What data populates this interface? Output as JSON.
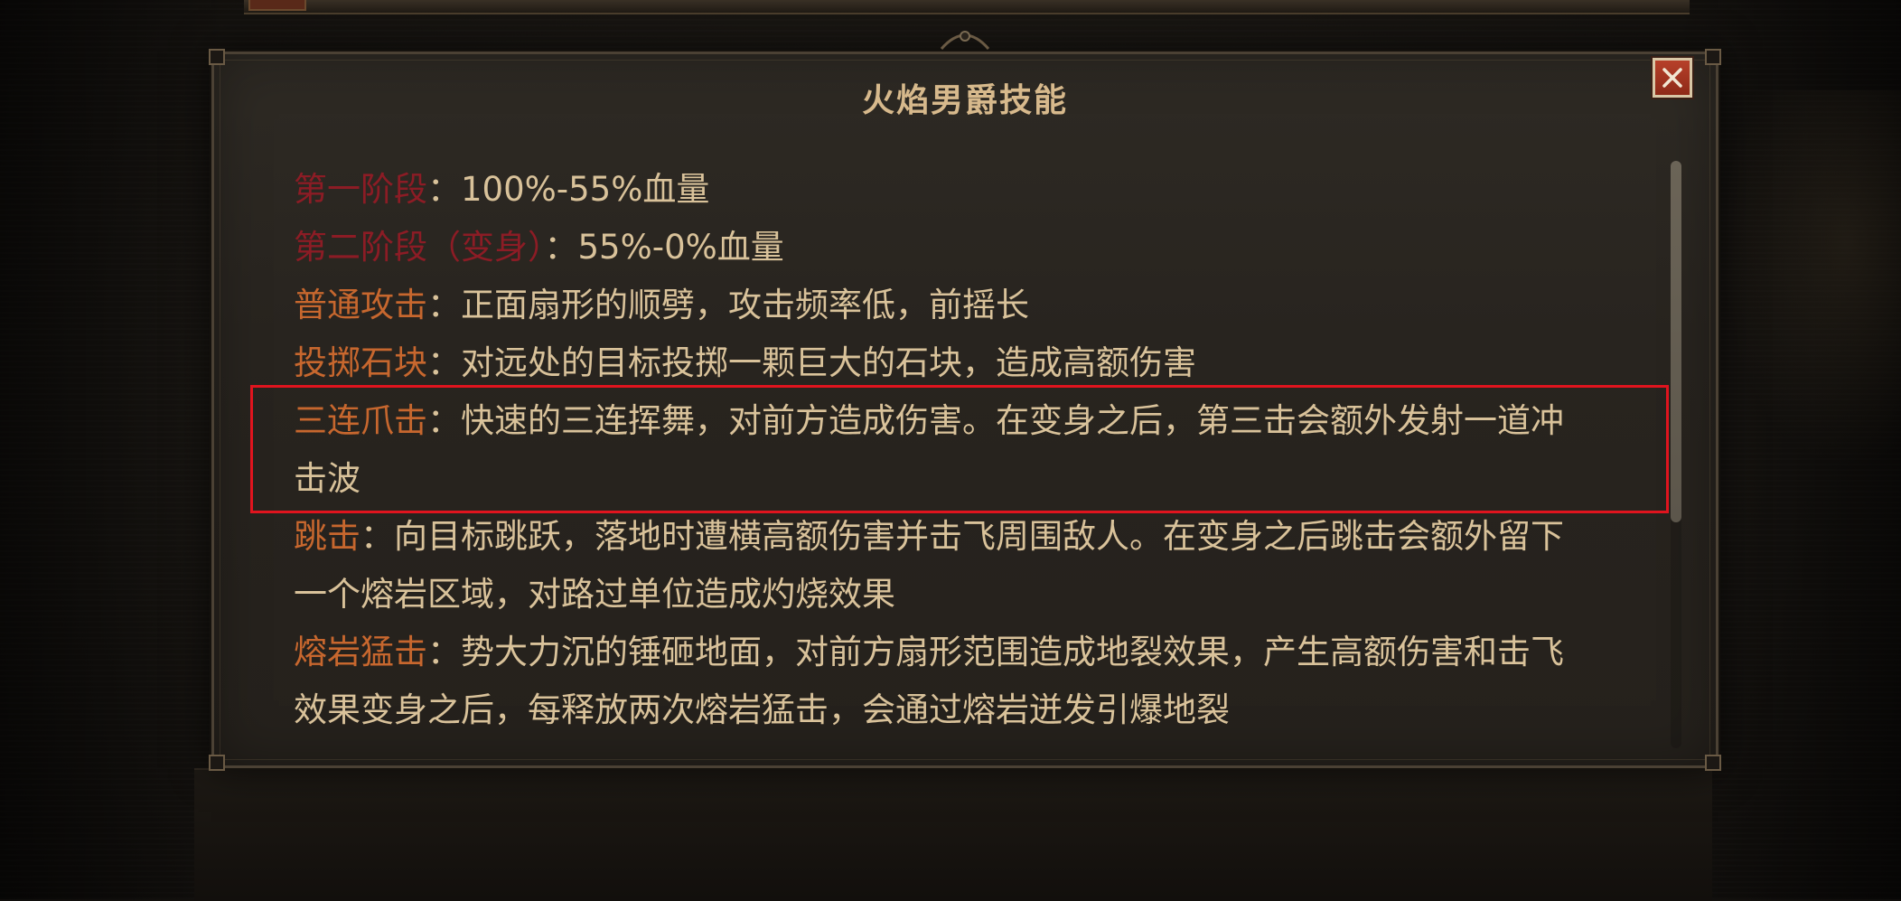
{
  "dialog": {
    "title": "火焰男爵技能",
    "close_icon": "close-icon"
  },
  "skills": [
    {
      "name": "第一阶段",
      "type": "phase",
      "separator": "：",
      "desc": "100%-55%血量"
    },
    {
      "name": "第二阶段（变身）",
      "type": "phase",
      "separator": "：",
      "desc": "55%-0%血量"
    },
    {
      "name": "普通攻击",
      "type": "attack",
      "separator": "：",
      "desc": "正面扇形的顺劈，攻击频率低，前摇长"
    },
    {
      "name": "投掷石块",
      "type": "attack",
      "separator": "：",
      "desc": "对远处的目标投掷一颗巨大的石块，造成高额伤害"
    },
    {
      "name": "三连爪击",
      "type": "attack",
      "separator": "：",
      "desc": "快速的三连挥舞，对前方造成伤害。在变身之后，第三击会额外发射一道冲击波"
    },
    {
      "name": "跳击",
      "type": "attack",
      "separator": "：",
      "desc": "向目标跳跃，落地时遭横高额伤害并击飞周围敌人。在变身之后跳击会额外留下一个熔岩区域，对路过单位造成灼烧效果"
    },
    {
      "name": "熔岩猛击",
      "type": "attack",
      "separator": "：",
      "desc": "势大力沉的锤砸地面，对前方扇形范围造成地裂效果，产生高额伤害和击飞效果变身之后，每释放两次熔岩猛击，会通过熔岩迸发引爆地裂"
    }
  ],
  "colors": {
    "title": "#d7b98c",
    "body_text": "#d9c29a",
    "phase_label": "#8c1c25",
    "attack_label": "#c7672e",
    "highlight_border": "#e0141e",
    "close_button": "#b7402a"
  }
}
